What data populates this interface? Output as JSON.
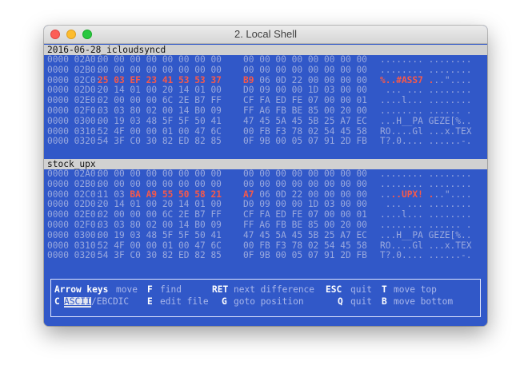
{
  "window": {
    "title": "2. Local Shell"
  },
  "sections": [
    {
      "title": "2016-06-28_icloudsyncd",
      "rows": [
        {
          "offset": "0000 02A0:",
          "a": "00 00 00 00 00 00 00 00",
          "b": "00 00 00 00 00 00 00 00",
          "ascii": "........ ........",
          "hl": false
        },
        {
          "offset": "0000 02B0:",
          "a": "00 00 00 00 00 00 00 00",
          "b": "00 00 00 00 00 00 00 00",
          "ascii": "........ ........",
          "hl": false
        },
        {
          "offset": "0000 02C0:",
          "a_hl": "25 03 EF 23 41 53 53 37",
          "b_hl": "B9",
          "b_rest": " 06 0D 22 00 00 00 00",
          "ascii_hl": "%..#ASS7 .",
          "ascii_rest": "..\"....",
          "hl": true
        },
        {
          "offset": "0000 02D0:",
          "a": "20 14 01 00 20 14 01 00",
          "b": "D0 09 00 00 1D 03 00 00",
          "ascii": " ... ... ........",
          "hl": false
        },
        {
          "offset": "0000 02E0:",
          "a": "02 00 00 00 6C 2E B7 FF",
          "b": "CF FA ED FE 07 00 00 01",
          "ascii": "....l... ........",
          "hl": false
        },
        {
          "offset": "0000 02F0:",
          "a": "03 03 80 02 00 14 B0 09",
          "b": "FF A6 FB BE 85 00 20 00",
          "ascii": "........ ...... .",
          "hl": false
        },
        {
          "offset": "0000 0300:",
          "a": "00 19 03 48 5F 5F 50 41",
          "b": "47 45 5A 45 5B 25 A7 EC",
          "ascii": "...H__PA GEZE[%..",
          "hl": false
        },
        {
          "offset": "0000 0310:",
          "a": "52 4F 00 00 01 00 47 6C",
          "b": "00 FB F3 78 02 54 45 58",
          "ascii": "RO....Gl ...x.TEX",
          "hl": false
        },
        {
          "offset": "0000 0320:",
          "a": "54 3F C0 30 82 ED 82 85",
          "b": "0F 9B 00 05 07 91 2D FB",
          "ascii": "T?.0.... ......-.",
          "hl": false
        }
      ]
    },
    {
      "title": "stock_upx",
      "rows": [
        {
          "offset": "0000 02A0:",
          "a": "00 00 00 00 00 00 00 00",
          "b": "00 00 00 00 00 00 00 00",
          "ascii": "........ ........",
          "hl": false
        },
        {
          "offset": "0000 02B0:",
          "a": "00 00 00 00 00 00 00 00",
          "b": "00 00 00 00 00 00 00 00",
          "ascii": "........ ........",
          "hl": false
        },
        {
          "offset": "0000 02C0:",
          "a_pre": "11 03 ",
          "a_hl": "BA A9 55 50 58 21",
          "b_hl": "A7",
          "b_rest": " 06 0D 22 00 00 00 00",
          "ascii_pre": "..",
          "ascii_hl": "..UPX! .",
          "ascii_rest": "..\"....",
          "hl": true
        },
        {
          "offset": "0000 02D0:",
          "a": "20 14 01 00 20 14 01 00",
          "b": "D0 09 00 00 1D 03 00 00",
          "ascii": " ... ... ........",
          "hl": false
        },
        {
          "offset": "0000 02E0:",
          "a": "02 00 00 00 6C 2E B7 FF",
          "b": "CF FA ED FE 07 00 00 01",
          "ascii": "....l... ........",
          "hl": false
        },
        {
          "offset": "0000 02F0:",
          "a": "03 03 80 02 00 14 B0 09",
          "b": "FF A6 FB BE 85 00 20 00",
          "ascii": "........ ...... .",
          "hl": false
        },
        {
          "offset": "0000 0300:",
          "a": "00 19 03 48 5F 5F 50 41",
          "b": "47 45 5A 45 5B 25 A7 EC",
          "ascii": "...H__PA GEZE[%..",
          "hl": false
        },
        {
          "offset": "0000 0310:",
          "a": "52 4F 00 00 01 00 47 6C",
          "b": "00 FB F3 78 02 54 45 58",
          "ascii": "RO....Gl ...x.TEX",
          "hl": false
        },
        {
          "offset": "0000 0320:",
          "a": "54 3F C0 30 82 ED 82 85",
          "b": "0F 9B 00 05 07 91 2D FB",
          "ascii": "T?.0.... ......-.",
          "hl": false
        }
      ]
    }
  ],
  "help": {
    "arrow_key": "Arrow keys",
    "arrow_desc": "move",
    "f_key": "F",
    "f_desc": "find",
    "ret_key": "RET",
    "ret_desc": "next difference",
    "esc_key": "ESC",
    "esc_desc": "quit",
    "t_key": "T",
    "t_desc": "move top",
    "c_key": "C",
    "ascii_mode": "ASCII",
    "ebcdic_mode": "/EBCDIC",
    "e_key": "E",
    "e_desc": "edit file",
    "g_key": "G",
    "g_desc": "goto position",
    "q_key": "Q",
    "q_desc": "quit",
    "b_key": "B",
    "b_desc": "move bottom"
  }
}
